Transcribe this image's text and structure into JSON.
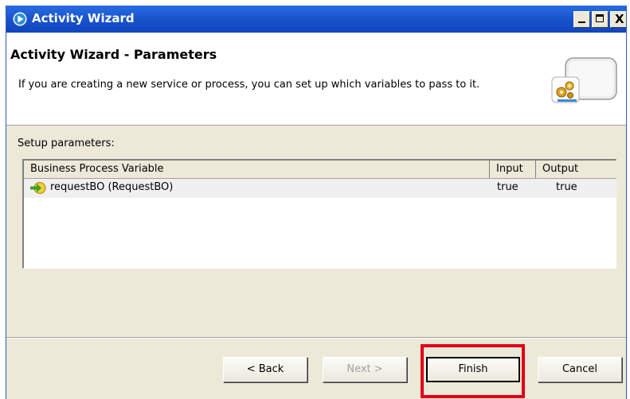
{
  "window": {
    "title": "Activity Wizard",
    "controls": {
      "minimize_icon": "minimize-icon",
      "maximize_icon": "maximize-icon",
      "close_label": "X"
    }
  },
  "header": {
    "title": "Activity Wizard - Parameters",
    "description": "If you are creating a new service or process, you can set up which variables to pass to it.",
    "graphic_icon": "gears-icon"
  },
  "setup_label": "Setup parameters:",
  "table": {
    "columns": [
      "Business Process Variable",
      "Input",
      "Output"
    ],
    "rows": [
      {
        "icon": "variable-arrow-icon",
        "variable": "requestBO (RequestBO)",
        "input": "true",
        "output": "true"
      }
    ]
  },
  "buttons": {
    "back": "< Back",
    "next": "Next >",
    "finish": "Finish",
    "cancel": "Cancel"
  },
  "annotation": {
    "highlight_color": "#e1001a"
  }
}
